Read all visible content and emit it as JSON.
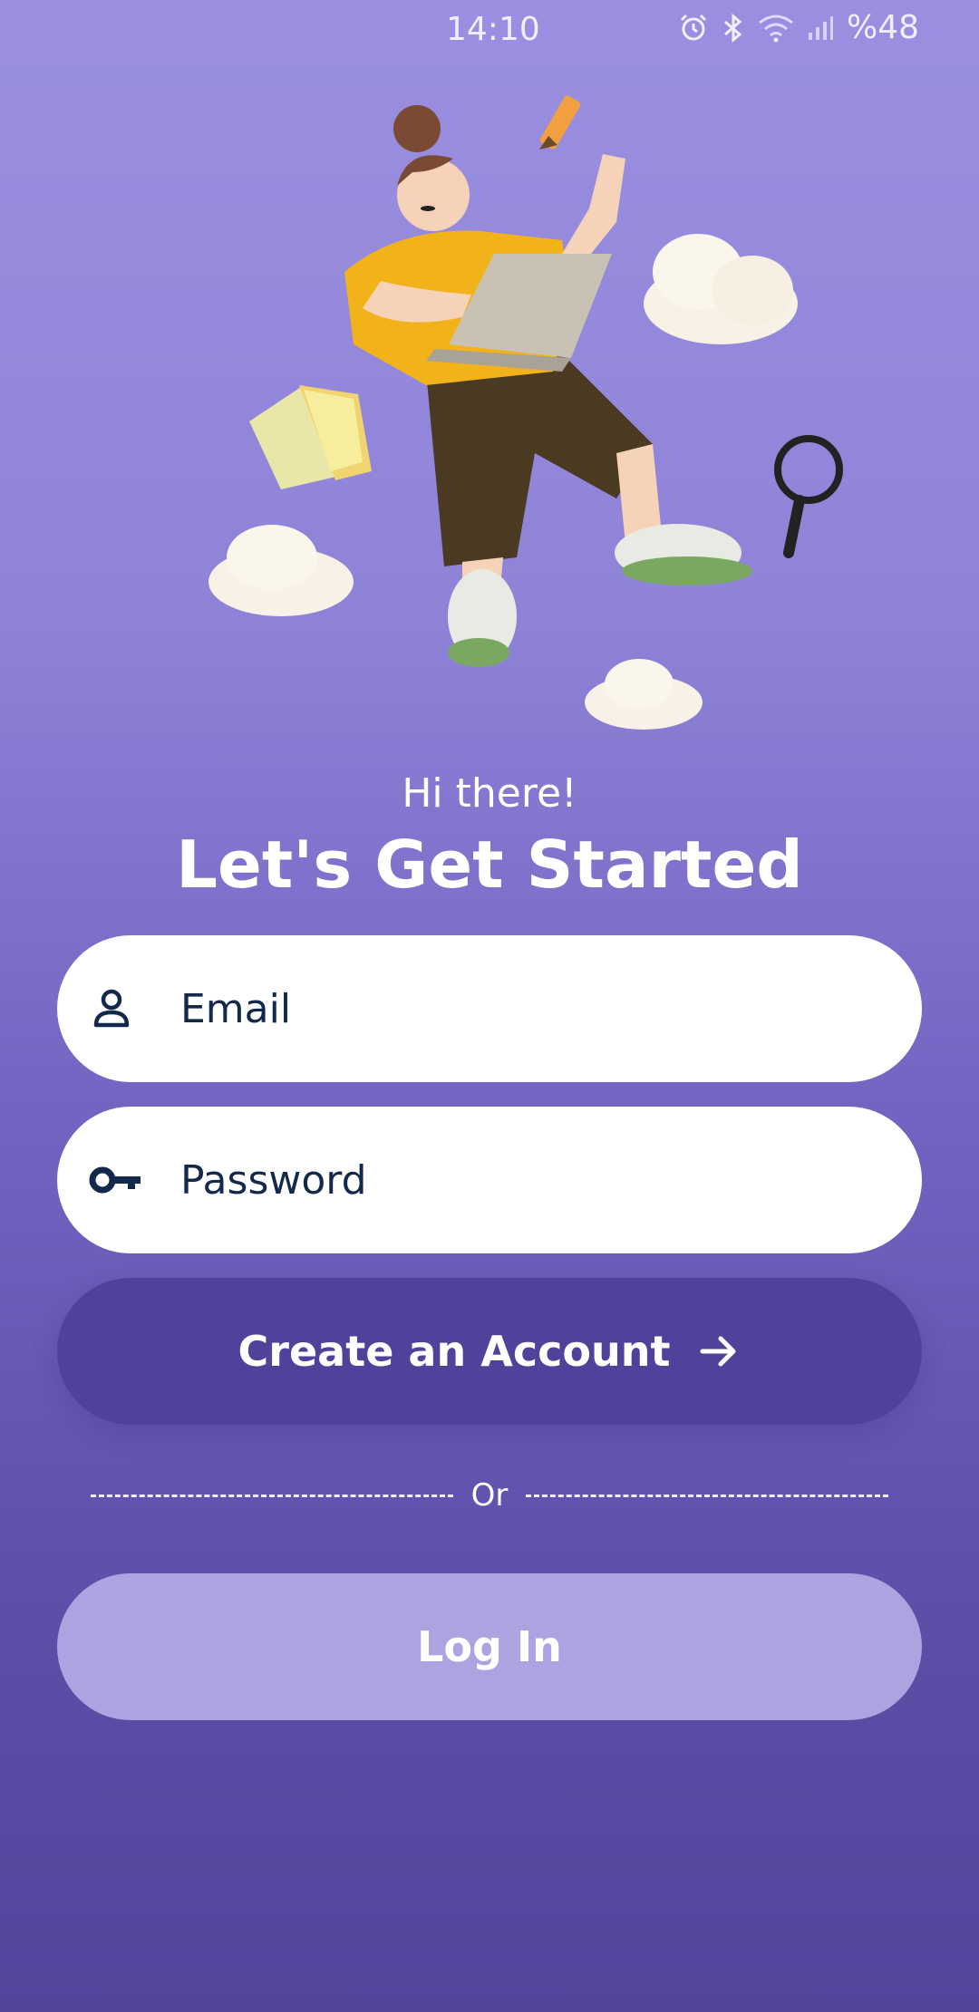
{
  "status_bar": {
    "time": "14:10",
    "battery": "%48",
    "icons": [
      "alarm-icon",
      "bluetooth-icon",
      "wifi-icon",
      "signal-icon"
    ]
  },
  "hero": {
    "illustration": "woman-with-laptop-floating-among-clouds"
  },
  "greeting": "Hi there!",
  "title": "Let's Get Started",
  "email": {
    "placeholder": "Email",
    "value": "",
    "icon": "person-icon"
  },
  "password": {
    "placeholder": "Password",
    "value": "",
    "icon": "key-icon"
  },
  "create_account": {
    "label": "Create an Account",
    "icon": "arrow-right-icon"
  },
  "divider": {
    "label": "Or"
  },
  "login": {
    "label": "Log In"
  },
  "colors": {
    "background_top": "#9a8fe0",
    "background_bottom": "#53449c",
    "primary_button": "#50429a",
    "secondary_button": "#aea3e1",
    "input_text": "#13294b"
  }
}
